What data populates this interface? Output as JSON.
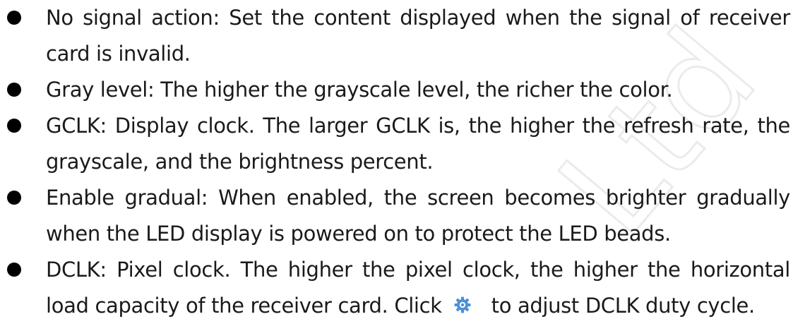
{
  "bullets": [
    {
      "text": "No signal action: Set the content displayed when the signal of receiver card is invalid."
    },
    {
      "text": "Gray level: The higher the grayscale level, the richer the color."
    },
    {
      "text": "GCLK: Display clock. The larger GCLK is, the higher the refresh rate, the grayscale, and the brightness percent."
    },
    {
      "text": "Enable gradual: When enabled, the screen becomes brighter gradually when the LED display is powered on to protect the LED beads."
    },
    {
      "text_before_icon": "DCLK: Pixel clock. The higher the pixel clock, the higher the horizontal load capacity of the receiver card. Click",
      "icon": "gear-settings-icon",
      "text_after_icon": "to adjust DCLK duty cycle."
    }
  ],
  "watermark": "Ltd",
  "colors": {
    "text": "#1a1a1a",
    "icon": "#4a90d9",
    "watermark": "#eeeeee"
  }
}
